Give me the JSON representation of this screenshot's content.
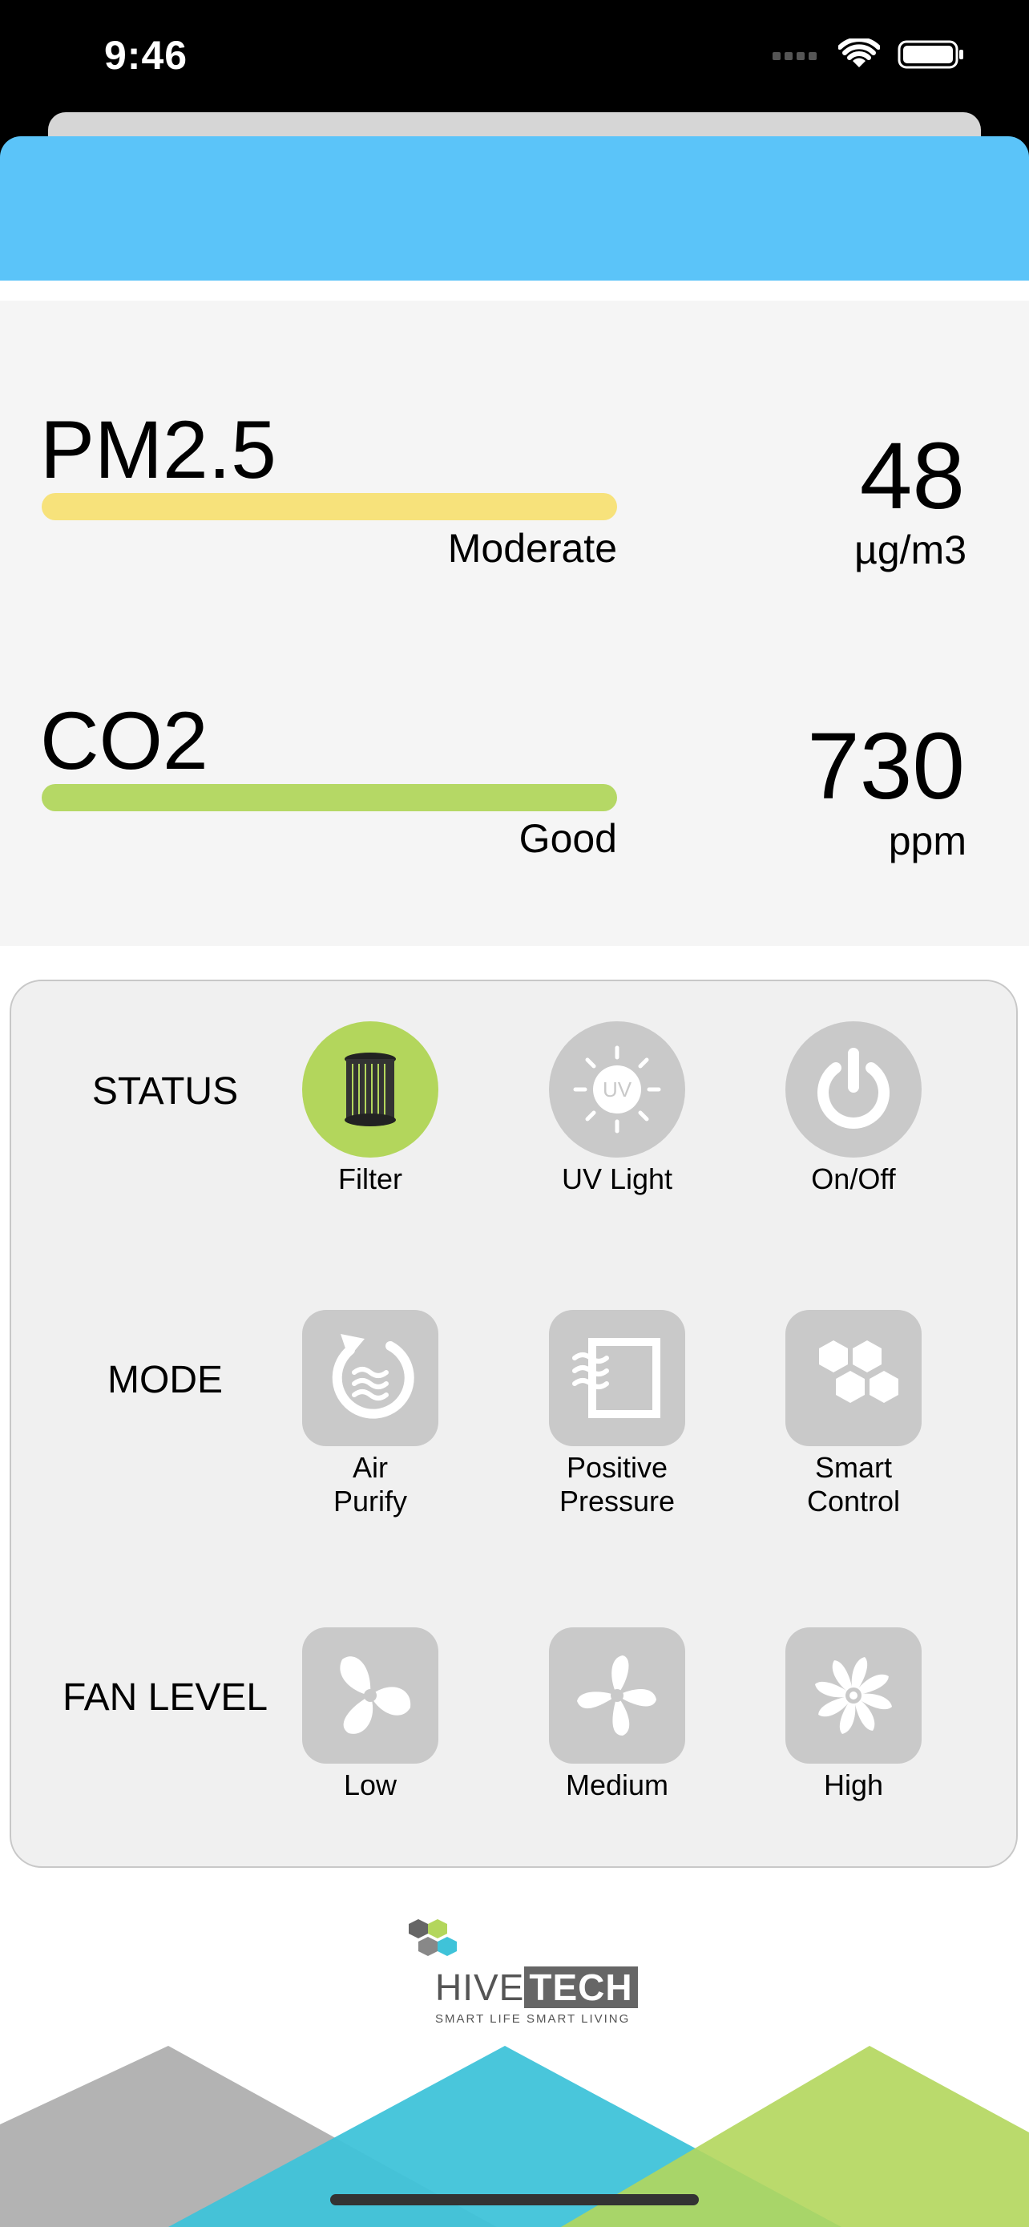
{
  "status_bar": {
    "time": "9:46"
  },
  "readings": [
    {
      "name": "PM2.5",
      "rating": "Moderate",
      "value": "48",
      "unit": "µg/m3",
      "bar_color": "#f7e27b"
    },
    {
      "name": "CO2",
      "rating": "Good",
      "value": "730",
      "unit": "ppm",
      "bar_color": "#b5d865"
    }
  ],
  "controls": {
    "status": {
      "label": "STATUS",
      "items": [
        {
          "label": "Filter",
          "icon": "filter-icon",
          "active": true
        },
        {
          "label": "UV Light",
          "icon": "uv-light-icon",
          "badge": "UV",
          "active": false
        },
        {
          "label": "On/Off",
          "icon": "power-icon",
          "active": false
        }
      ]
    },
    "mode": {
      "label": "MODE",
      "items": [
        {
          "label": "Air\nPurify",
          "icon": "air-purify-icon"
        },
        {
          "label": "Positive\nPressure",
          "icon": "positive-pressure-icon"
        },
        {
          "label": "Smart\nControl",
          "icon": "smart-control-icon"
        }
      ]
    },
    "fan_level": {
      "label": "FAN LEVEL",
      "items": [
        {
          "label": "Low",
          "icon": "fan-low-icon"
        },
        {
          "label": "Medium",
          "icon": "fan-medium-icon"
        },
        {
          "label": "High",
          "icon": "fan-high-icon"
        }
      ]
    }
  },
  "logo": {
    "hive": "HIVE",
    "tech": "TECH",
    "tagline": "SMART LIFE SMART LIVING"
  },
  "colors": {
    "accent_blue": "#5bc4f9",
    "active_green": "#b3d65c",
    "inactive_gray": "#c9c9c9",
    "teal": "#3fc3d9",
    "lime": "#b5d865"
  }
}
